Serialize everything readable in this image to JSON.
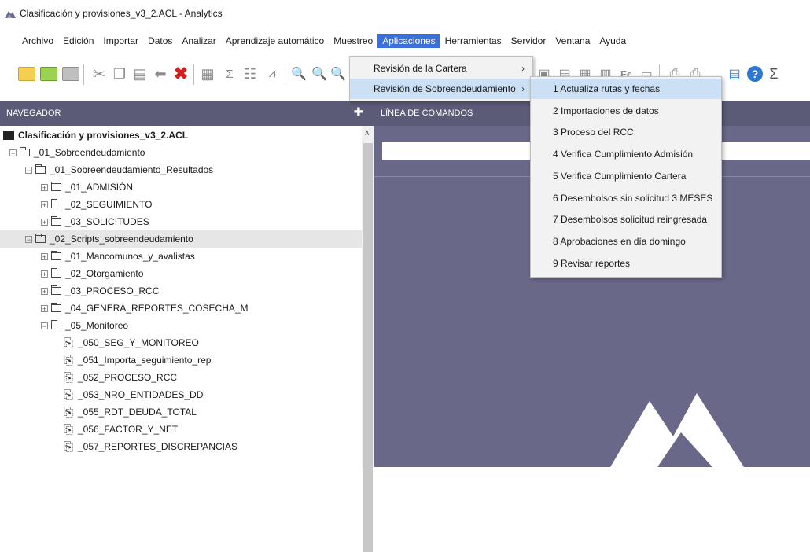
{
  "window": {
    "title": "Clasificación y provisiones_v3_2.ACL - Analytics",
    "icon": "acl-analytics-logo-icon"
  },
  "menubar": {
    "items": [
      "Archivo",
      "Edición",
      "Importar",
      "Datos",
      "Analizar",
      "Aprendizaje automático",
      "Muestreo",
      "Aplicaciones",
      "Herramientas",
      "Servidor",
      "Ventana",
      "Ayuda"
    ],
    "active": "Aplicaciones"
  },
  "toolbar": {
    "sigma": "Σ",
    "help": "?"
  },
  "navigator": {
    "header": "NAVEGADOR",
    "tree": [
      {
        "label": "Clasificación y provisiones_v3_2.ACL",
        "type": "project",
        "level": 0
      },
      {
        "label": "_01_Sobreendeudamiento",
        "type": "folder",
        "expander": "−",
        "level": 0
      },
      {
        "label": "_01_Sobreendeudamiento_Resultados",
        "type": "folder",
        "expander": "−",
        "level": 1
      },
      {
        "label": "_01_ADMISIÓN",
        "type": "folder",
        "expander": "+",
        "level": 2
      },
      {
        "label": "_02_SEGUIMIENTO",
        "type": "folder",
        "expander": "+",
        "level": 2
      },
      {
        "label": "_03_SOLICITUDES",
        "type": "folder",
        "expander": "+",
        "level": 2
      },
      {
        "label": "_02_Scripts_sobreendeudamiento",
        "type": "folder",
        "expander": "−",
        "level": 1,
        "selected": true
      },
      {
        "label": "_01_Mancomunos_y_avalistas",
        "type": "folder",
        "expander": "+",
        "level": 2
      },
      {
        "label": "_02_Otorgamiento",
        "type": "folder",
        "expander": "+",
        "level": 2
      },
      {
        "label": "_03_PROCESO_RCC",
        "type": "folder",
        "expander": "+",
        "level": 2
      },
      {
        "label": "_04_GENERA_REPORTES_COSECHA_M",
        "type": "folder",
        "expander": "+",
        "level": 2
      },
      {
        "label": "_05_Monitoreo",
        "type": "folder",
        "expander": "−",
        "level": 2
      },
      {
        "label": "_050_SEG_Y_MONITOREO",
        "type": "script",
        "level": 3
      },
      {
        "label": "_051_Importa_seguimiento_rep",
        "type": "script",
        "level": 3
      },
      {
        "label": "_052_PROCESO_RCC",
        "type": "script",
        "level": 3
      },
      {
        "label": "_053_NRO_ENTIDADES_DD",
        "type": "script",
        "level": 3
      },
      {
        "label": "_055_RDT_DEUDA_TOTAL",
        "type": "script",
        "level": 3
      },
      {
        "label": "_056_FACTOR_Y_NET",
        "type": "script",
        "level": 3
      },
      {
        "label": "_057_REPORTES_DISCREPANCIAS",
        "type": "script",
        "level": 3
      }
    ]
  },
  "command_line": {
    "header": "LÍNEA DE COMANDOS",
    "value": ""
  },
  "applications_menu": {
    "items": [
      {
        "label": "Revisión de la Cartera",
        "arrow": "›"
      },
      {
        "label": "Revisión de Sobreendeudamiento",
        "arrow": "›",
        "hover": true
      }
    ]
  },
  "submenu": {
    "items": [
      "1 Actualiza rutas y fechas",
      "2 Importaciones de datos",
      "3 Proceso del RCC",
      "4 Verifica Cumplimiento Admisión",
      "5 Verifica Cumplimiento Cartera",
      "6 Desembolsos sin solicitud 3 MESES",
      "7 Desembolsos solicitud reingresada",
      "8 Aprobaciones en día domingo",
      "9 Revisar reportes"
    ],
    "hover_index": 0
  },
  "colors": {
    "panel_header": "#5b5a77",
    "command_area": "#6a6889",
    "menu_active": "#3d6fd8",
    "hover": "#cce0f5"
  }
}
